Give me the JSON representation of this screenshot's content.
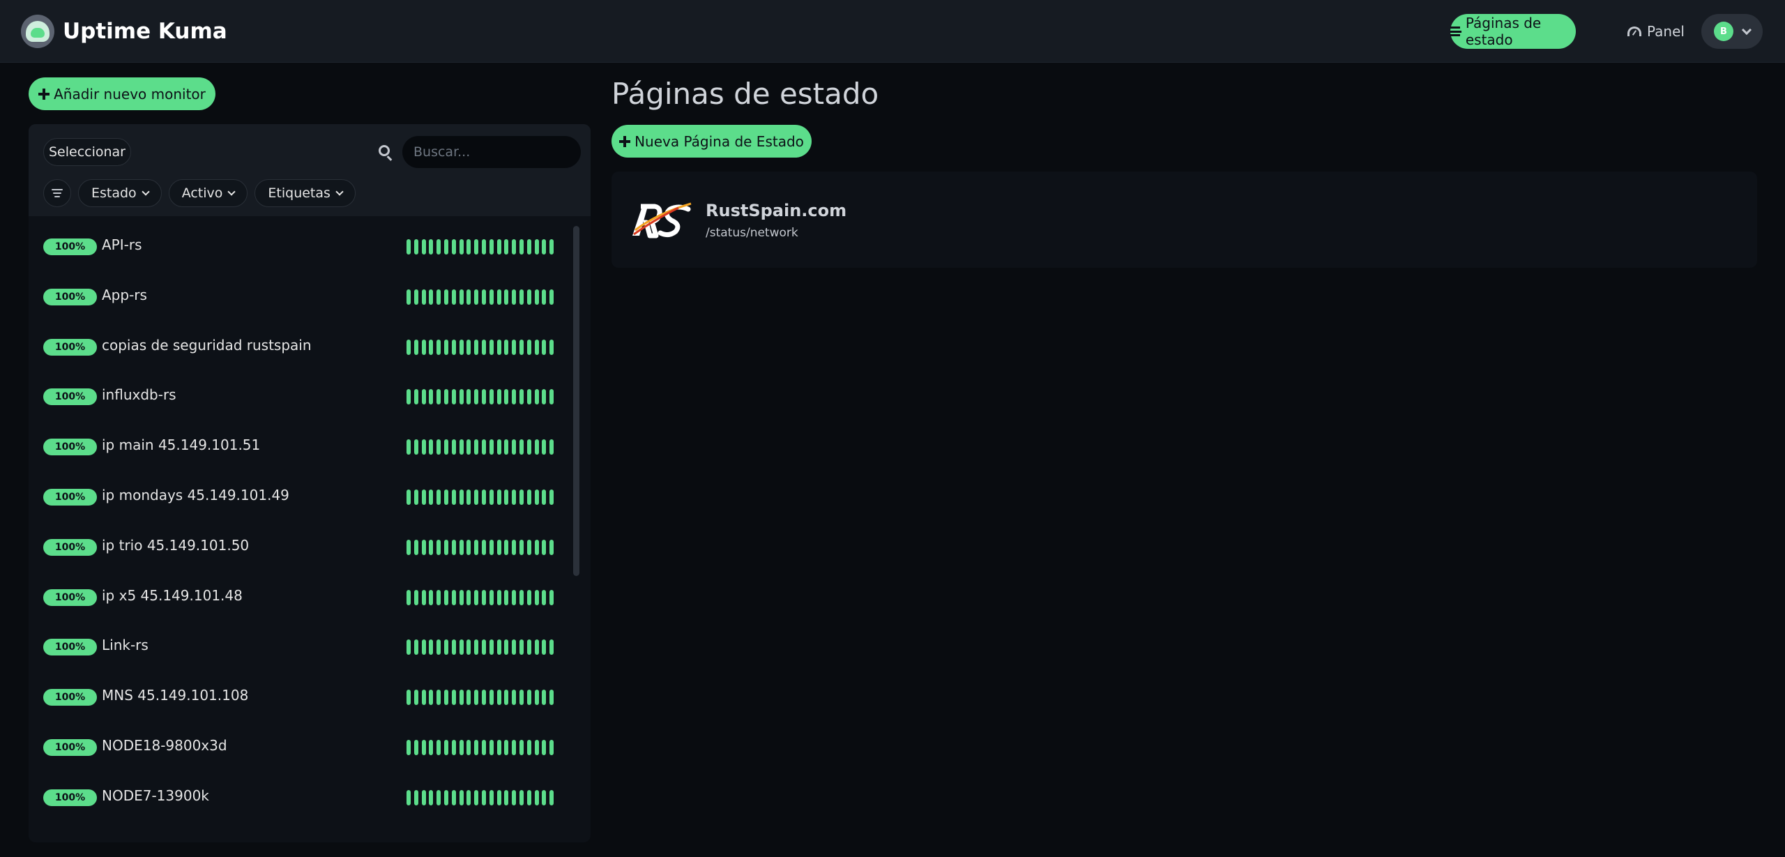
{
  "app": {
    "name": "Uptime Kuma"
  },
  "header": {
    "status_pages_label": "Páginas de estado",
    "panel_label": "Panel",
    "avatar_initial": "B"
  },
  "sidebar": {
    "add_monitor_label": "Añadir nuevo monitor",
    "select_label": "Seleccionar",
    "search_placeholder": "Buscar...",
    "filters": [
      {
        "label": "Estado"
      },
      {
        "label": "Activo"
      },
      {
        "label": "Etiquetas"
      }
    ],
    "monitors": [
      {
        "uptime": "100%",
        "name": "API-rs"
      },
      {
        "uptime": "100%",
        "name": "App-rs"
      },
      {
        "uptime": "100%",
        "name": "copias de seguridad rustspain"
      },
      {
        "uptime": "100%",
        "name": "influxdb-rs"
      },
      {
        "uptime": "100%",
        "name": "ip main 45.149.101.51"
      },
      {
        "uptime": "100%",
        "name": "ip mondays 45.149.101.49"
      },
      {
        "uptime": "100%",
        "name": "ip trio 45.149.101.50"
      },
      {
        "uptime": "100%",
        "name": "ip x5 45.149.101.48"
      },
      {
        "uptime": "100%",
        "name": "Link-rs"
      },
      {
        "uptime": "100%",
        "name": "MNS 45.149.101.108"
      },
      {
        "uptime": "100%",
        "name": "NODE18-9800x3d"
      },
      {
        "uptime": "100%",
        "name": "NODE7-13900k"
      }
    ],
    "heartbeat_count": 20
  },
  "main": {
    "title": "Páginas de estado",
    "new_page_label": "Nueva Página de Estado",
    "status_pages": [
      {
        "title": "RustSpain.com",
        "slug": "/status/network",
        "logo": "rs-logo"
      }
    ]
  },
  "colors": {
    "accent": "#5cdd8b",
    "background": "#090c10",
    "header": "#161b22",
    "panel": "#0d1117"
  },
  "icons": {
    "status_pages_button": "list-icon",
    "panel_link": "gauge-icon",
    "profile_menu": "chevron-down-icon",
    "search": "search-icon",
    "filter_list": "filter-list-icon",
    "add": "plus-icon"
  }
}
